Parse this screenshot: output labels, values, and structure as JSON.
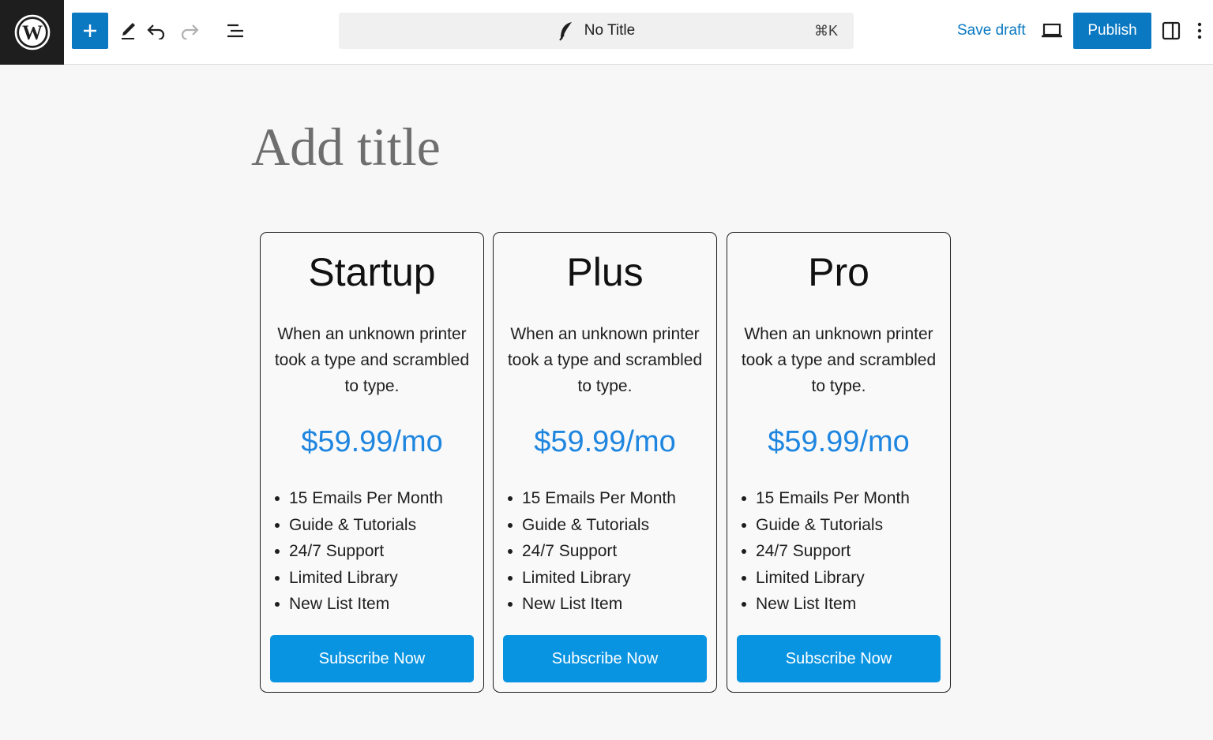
{
  "toolbar": {
    "logo_icon": "wordpress-logo",
    "add_block_icon": "plus-icon",
    "tools_icon": "pen-icon",
    "undo_icon": "undo-icon",
    "redo_icon": "redo-icon",
    "list_view_icon": "list-view-icon",
    "command_bar": {
      "icon": "feather-icon",
      "title": "No Title",
      "shortcut": "⌘K"
    },
    "save_draft_label": "Save draft",
    "preview_icon": "laptop-icon",
    "publish_label": "Publish",
    "settings_icon": "sidebar-toggle-icon",
    "options_icon": "more-vertical-icon",
    "accent_color": "#0a79c2"
  },
  "editor": {
    "title_placeholder": "Add title"
  },
  "pricing": {
    "price_color": "#1f86e0",
    "button_color": "#0994e2",
    "cards": [
      {
        "name": "Startup",
        "description": "When an unknown printer took a type and scrambled to type.",
        "price": "$59.99/mo",
        "features": [
          "15 Emails Per Month",
          "Guide & Tutorials",
          "24/7 Support",
          "Limited Library",
          "New List Item"
        ],
        "button_label": "Subscribe Now"
      },
      {
        "name": "Plus",
        "description": "When an unknown printer took a type and scrambled to type.",
        "price": "$59.99/mo",
        "features": [
          "15 Emails Per Month",
          "Guide & Tutorials",
          "24/7 Support",
          "Limited Library",
          "New List Item"
        ],
        "button_label": "Subscribe Now"
      },
      {
        "name": "Pro",
        "description": "When an unknown printer took a type and scrambled to type.",
        "price": "$59.99/mo",
        "features": [
          "15 Emails Per Month",
          "Guide & Tutorials",
          "24/7 Support",
          "Limited Library",
          "New List Item"
        ],
        "button_label": "Subscribe Now"
      }
    ]
  }
}
